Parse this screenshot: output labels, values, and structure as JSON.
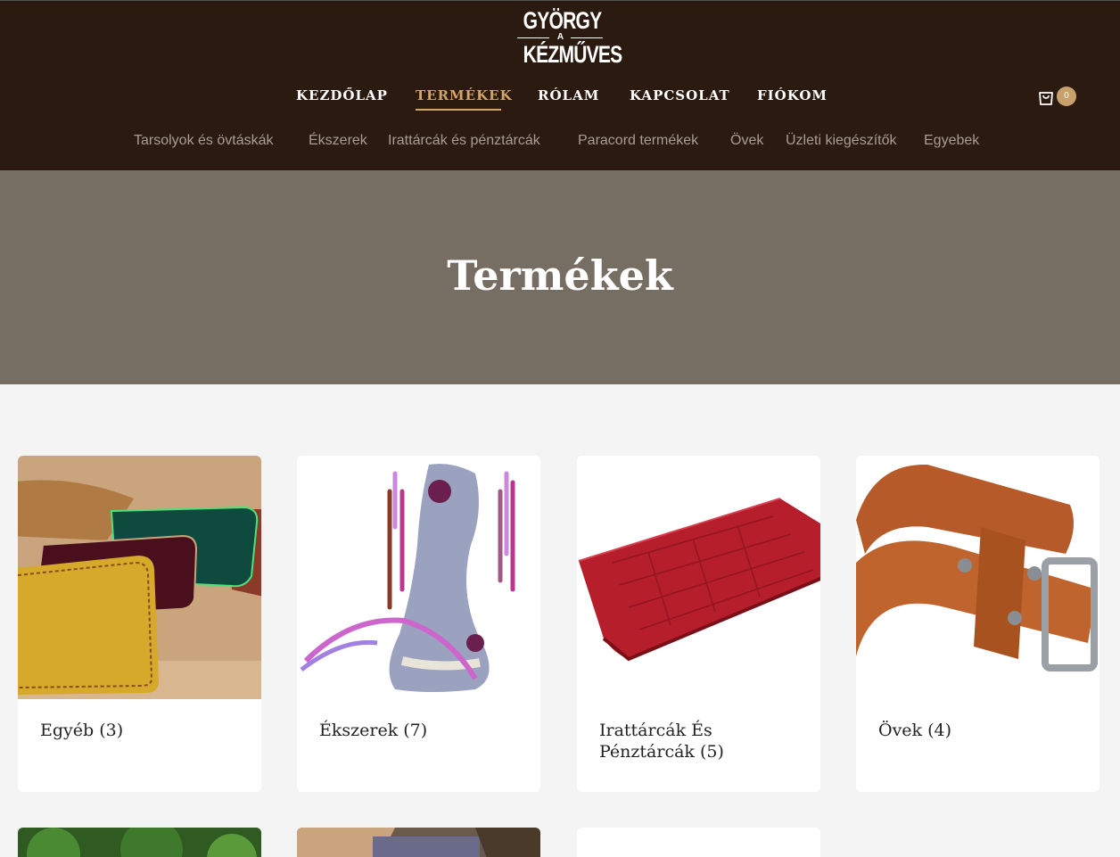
{
  "logo": {
    "line1": "GYÖRGY",
    "line2": "A",
    "line3": "KÉZMŰVES"
  },
  "nav": {
    "items": [
      {
        "label": "KEZDŐLAP",
        "active": false
      },
      {
        "label": "TERMÉKEK",
        "active": true
      },
      {
        "label": "RÓLAM",
        "active": false
      },
      {
        "label": "KAPCSOLAT",
        "active": false
      },
      {
        "label": "FIÓKOM",
        "active": false
      }
    ]
  },
  "cart": {
    "icon": "shopping-bag-icon",
    "count": "0"
  },
  "subnav": {
    "items": [
      "Tarsolyok és övtáskák",
      "Ékszerek",
      "Irattárcák és pénztárcák",
      "Paracord termékek",
      "Övek",
      "Üzleti kiegészítők",
      "Egyebek"
    ]
  },
  "hero": {
    "title": "Termékek"
  },
  "categories": [
    {
      "label": "Egyéb (3)"
    },
    {
      "label": "Ékszerek (7)"
    },
    {
      "label": "Irattárcák És Pénztárcák (5)"
    },
    {
      "label": "Övek (4)"
    }
  ],
  "colors": {
    "header_bg": "#2a1a10",
    "accent": "#d4a56a",
    "hero_bg": "#766d63",
    "page_bg": "#f4f4f4",
    "subnav_text": "#a99e92"
  }
}
